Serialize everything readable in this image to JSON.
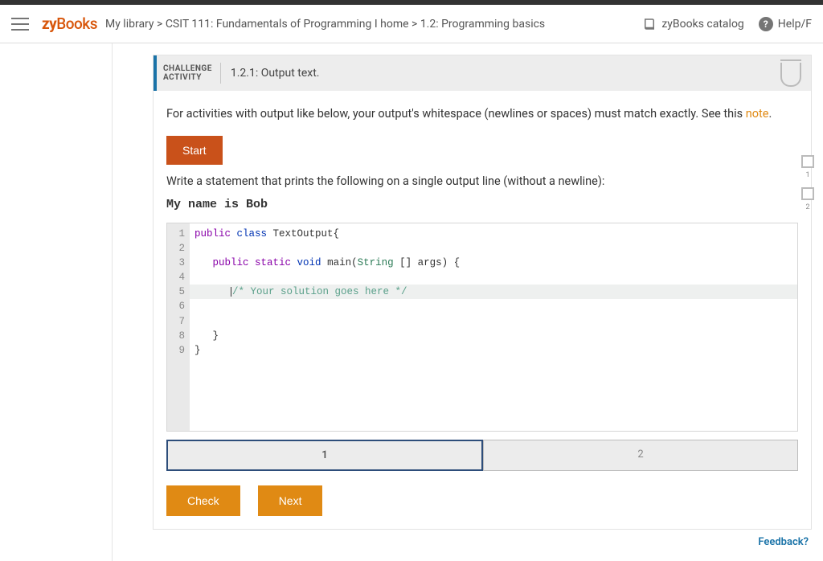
{
  "brand": {
    "zy": "zy",
    "books": "Books"
  },
  "breadcrumb": "My library > CSIT 111: Fundamentals of Programming I home > 1.2: Programming basics",
  "header": {
    "catalog": "zyBooks catalog",
    "help": "Help/F"
  },
  "activity": {
    "badge1": "CHALLENGE",
    "badge2": "ACTIVITY",
    "title": "1.2.1: Output text."
  },
  "note": {
    "text": "For activities with output like below, your output's whitespace (newlines or spaces) must match exactly. See this ",
    "link": "note",
    "suffix": "."
  },
  "start": "Start",
  "instruction": "Write a statement that prints the following on a single output line (without a newline):",
  "target_output": "My name is Bob",
  "code": {
    "lines": [
      "1",
      "2",
      "3",
      "4",
      "5",
      "6",
      "7",
      "8",
      "9"
    ],
    "l1a": "public",
    "l1b": " class",
    "l1c": " TextOutput{",
    "l3a": "public",
    "l3b": " static",
    "l3c": " void",
    "l3d": " main(",
    "l3e": "String",
    "l3f": " [] args) {",
    "l5": "/* Your solution goes here */",
    "l7": "   }",
    "l8": "}"
  },
  "pager": {
    "p1": "1",
    "p2": "2"
  },
  "checks": {
    "n1": "1",
    "n2": "2"
  },
  "buttons": {
    "check": "Check",
    "next": "Next"
  },
  "feedback": "Feedback?"
}
